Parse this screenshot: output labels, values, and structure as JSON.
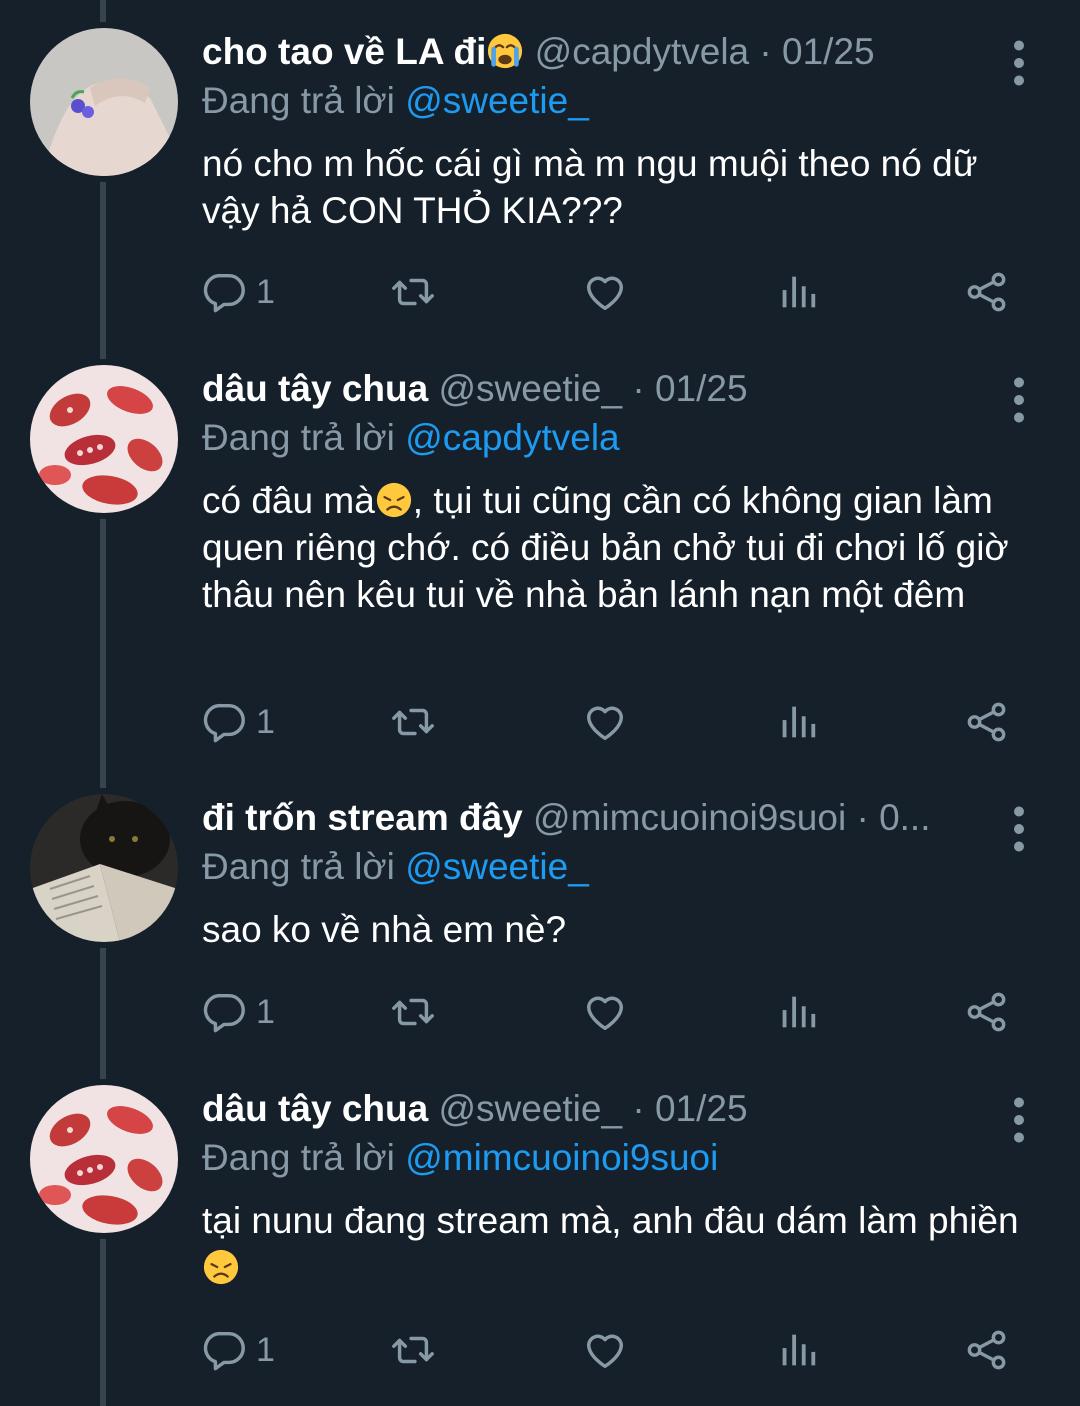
{
  "tweets": [
    {
      "display_name": "cho tao về LA đi",
      "name_emoji": "crying-face",
      "handle": "@capdytvela",
      "date_sep": " · ",
      "date": "01/25",
      "reply_prefix": "Đang trả lời ",
      "reply_to": "@sweetie_",
      "text": "nó cho m hốc cái gì mà m ngu muội theo nó dữ vậy hả CON THỎ KIA???",
      "reply_count": "1"
    },
    {
      "display_name": "dâu tây chua",
      "handle": "@sweetie_",
      "date_sep": " · ",
      "date": "01/25",
      "reply_prefix": "Đang trả lời ",
      "reply_to": "@capdytvela",
      "text_before_emoji": "có đâu mà",
      "text_emoji": "disappointed-face",
      "text_after_emoji": ", tụi tui cũng cần có không gian làm quen riêng chớ. có điều bản chở tui đi chơi lố giờ thâu nên kêu tui về nhà bản lánh nạn một đêm",
      "reply_count": "1"
    },
    {
      "display_name": "đi trốn stream đây",
      "handle": "@mimcuoinoi9suoi",
      "date_sep": " · ",
      "date": "0...",
      "reply_prefix": "Đang trả lời ",
      "reply_to": "@sweetie_",
      "text": "sao ko về nhà em nè?",
      "reply_count": "1"
    },
    {
      "display_name": "dâu tây chua",
      "handle": "@sweetie_",
      "date_sep": " · ",
      "date": "01/25",
      "reply_prefix": "Đang trả lời ",
      "reply_to": "@mimcuoinoi9suoi",
      "text_before_emoji": "tại nunu đang stream mà, anh đâu dám làm phiền",
      "text_emoji": "disappointed-face",
      "reply_count": "1"
    }
  ],
  "icons": {
    "reply": "reply-icon",
    "retweet": "retweet-icon",
    "like": "heart-icon",
    "analytics": "analytics-icon",
    "share": "share-icon",
    "more": "more-vertical-icon"
  },
  "colors": {
    "background": "#15202b",
    "text": "#ffffff",
    "muted": "#8899a6",
    "accent": "#1d9bf0",
    "thread_line": "#38444d"
  }
}
